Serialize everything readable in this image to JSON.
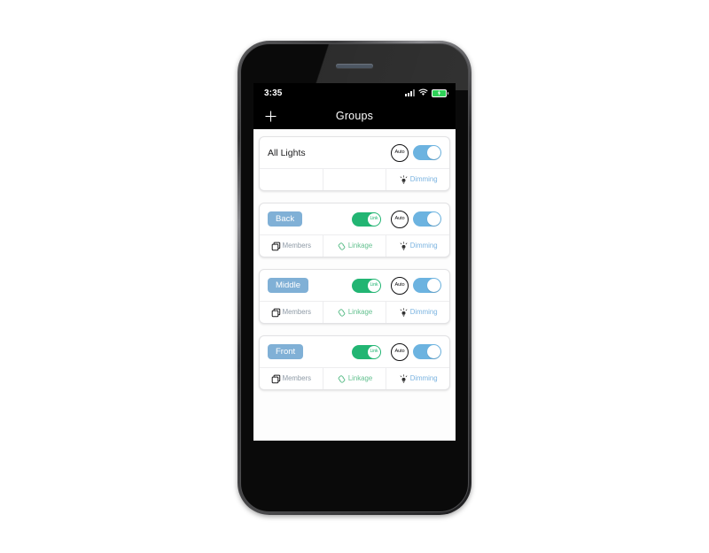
{
  "status_bar": {
    "time": "3:35",
    "signal_icon": "cellular-signal-icon",
    "wifi_icon": "wifi-icon",
    "battery_icon": "battery-charging-icon",
    "battery_color": "#2fd158"
  },
  "nav_bar": {
    "add_icon": "plus-icon",
    "title": "Groups"
  },
  "theme": {
    "chip_blue": "#80b0d6",
    "toggle_blue": "#6cb3e0",
    "toggle_green": "#22b573",
    "linkage_green": "#63c08f",
    "dimming_blue": "#7ab3e0",
    "members_gray": "#8e9aa6"
  },
  "labels": {
    "auto": "Auto",
    "link": "Link",
    "members": "Members",
    "linkage": "Linkage",
    "dimming": "Dimming"
  },
  "groups": [
    {
      "name": "All Lights",
      "name_style": "plain",
      "has_link_toggle": false,
      "link_on": false,
      "auto": "Auto",
      "power_on": true,
      "actions": [
        {
          "type": "empty",
          "label": ""
        },
        {
          "type": "empty",
          "label": ""
        },
        {
          "type": "dimming",
          "label": "Dimming",
          "icon": "bulb-icon"
        }
      ]
    },
    {
      "name": "Back",
      "name_style": "chip",
      "has_link_toggle": true,
      "link_on": true,
      "link_label": "Link",
      "auto": "Auto",
      "power_on": true,
      "actions": [
        {
          "type": "members",
          "label": "Members",
          "icon": "copy-squares-icon"
        },
        {
          "type": "linkage",
          "label": "Linkage",
          "icon": "chain-link-icon"
        },
        {
          "type": "dimming",
          "label": "Dimming",
          "icon": "bulb-icon"
        }
      ]
    },
    {
      "name": "Middle",
      "name_style": "chip",
      "has_link_toggle": true,
      "link_on": true,
      "link_label": "Link",
      "auto": "Auto",
      "power_on": true,
      "actions": [
        {
          "type": "members",
          "label": "Members",
          "icon": "copy-squares-icon"
        },
        {
          "type": "linkage",
          "label": "Linkage",
          "icon": "chain-link-icon"
        },
        {
          "type": "dimming",
          "label": "Dimming",
          "icon": "bulb-icon"
        }
      ]
    },
    {
      "name": "Front",
      "name_style": "chip",
      "has_link_toggle": true,
      "link_on": true,
      "link_label": "Link",
      "auto": "Auto",
      "power_on": true,
      "actions": [
        {
          "type": "members",
          "label": "Members",
          "icon": "copy-squares-icon"
        },
        {
          "type": "linkage",
          "label": "Linkage",
          "icon": "chain-link-icon"
        },
        {
          "type": "dimming",
          "label": "Dimming",
          "icon": "bulb-icon"
        }
      ]
    }
  ]
}
